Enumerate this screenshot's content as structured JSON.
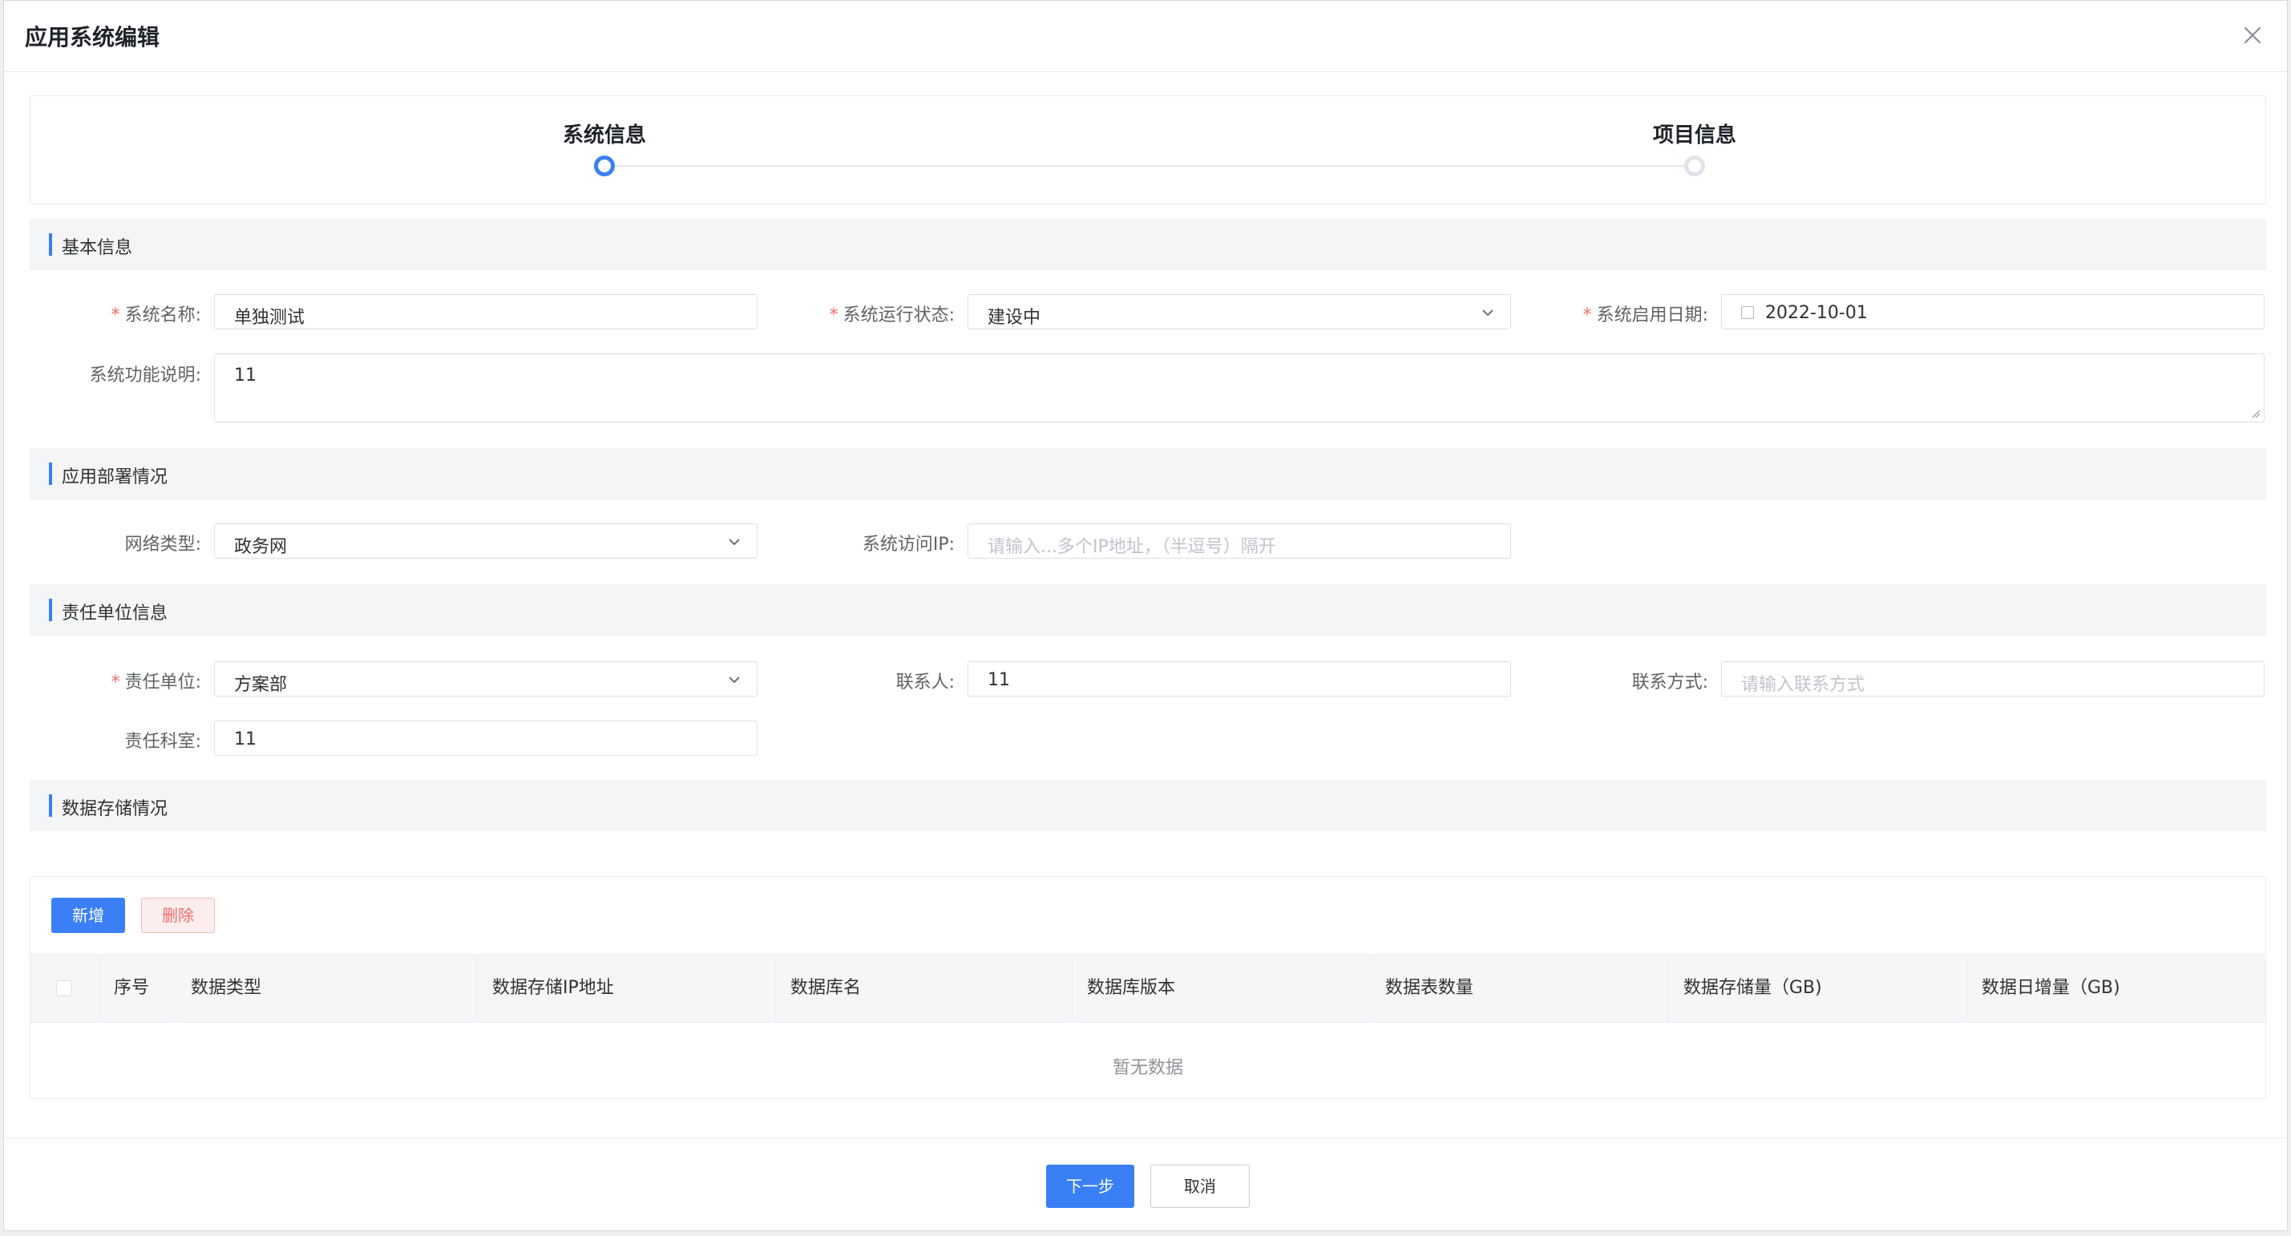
{
  "dialog": {
    "title": "应用系统编辑",
    "close_icon": "close-icon"
  },
  "steps": [
    {
      "label": "系统信息",
      "state": "active"
    },
    {
      "label": "项目信息",
      "state": "inactive"
    }
  ],
  "sections": {
    "basic": "基本信息",
    "deploy": "应用部署情况",
    "responsible": "责任单位信息",
    "storage": "数据存储情况"
  },
  "basic": {
    "name_label": "系统名称:",
    "name_value": "单独测试",
    "status_label": "系统运行状态:",
    "status_value": "建设中",
    "date_label": "系统启用日期:",
    "date_value": "2022-10-01",
    "desc_label": "系统功能说明:",
    "desc_value": "11"
  },
  "deploy": {
    "network_label": "网络类型:",
    "network_value": "政务网",
    "ip_label": "系统访问IP:",
    "ip_placeholder": "请输入...多个IP地址，（半逗号）隔开"
  },
  "responsible": {
    "unit_label": "责任单位:",
    "unit_value": "方案部",
    "contact_label": "联系人:",
    "contact_value": "11",
    "phone_label": "联系方式:",
    "phone_placeholder": "请输入联系方式",
    "dept_label": "责任科室:",
    "dept_value": "11"
  },
  "storage": {
    "add_label": "新增",
    "delete_label": "删除",
    "columns": [
      "序号",
      "数据类型",
      "数据存储IP地址",
      "数据库名",
      "数据库版本",
      "数据表数量",
      "数据存储量（GB)",
      "数据日增量（GB)"
    ],
    "empty_text": "暂无数据"
  },
  "footer": {
    "next_label": "下一步",
    "cancel_label": "取消"
  },
  "colors": {
    "primary": "#3a7ff6",
    "required": "#f56c6c",
    "danger_bg": "#fdeeee"
  }
}
